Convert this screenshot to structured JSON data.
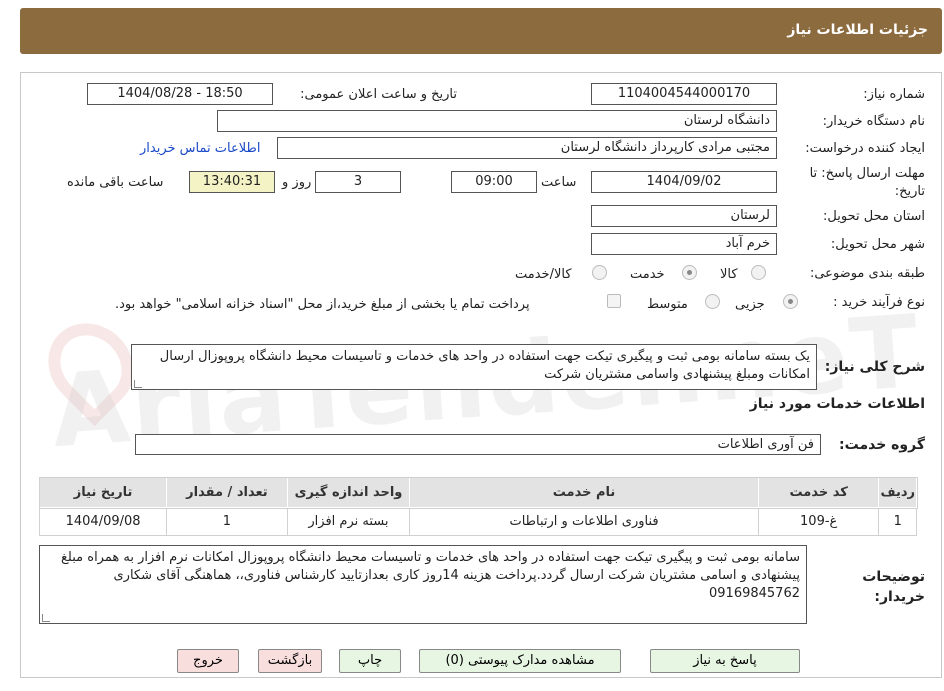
{
  "header": {
    "title": "جزئیات اطلاعات نیاز"
  },
  "watermark": "AriaTender.neT",
  "form": {
    "need_number_label": "شماره نیاز:",
    "need_number": "1104004544000170",
    "announce_label": "تاریخ و ساعت اعلان عمومی:",
    "announce_value": "1404/08/28 - 18:50",
    "buyer_org_label": "نام دستگاه خریدار:",
    "buyer_org": "دانشگاه لرستان",
    "creator_label": "ایجاد کننده درخواست:",
    "creator": "مجتبی مرادی کارپرداز دانشگاه لرستان",
    "contact_link": "اطلاعات تماس خریدار",
    "deadline_label": "مهلت ارسال پاسخ: تا تاریخ:",
    "deadline_date": "1404/09/02",
    "time_label": "ساعت",
    "deadline_time": "09:00",
    "days_value": "3",
    "days_label": "روز و",
    "remaining_time": "13:40:31",
    "remaining_label": "ساعت باقی مانده",
    "province_label": "استان محل تحویل:",
    "province": "لرستان",
    "city_label": "شهر محل تحویل:",
    "city": "خرم آباد",
    "category_label": "طبقه بندی موضوعی:",
    "category_options": [
      "کالا",
      "خدمت",
      "کالا/خدمت"
    ],
    "purchase_type_label": "نوع فرآیند خرید :",
    "purchase_options": [
      "جزیی",
      "متوسط"
    ],
    "payment_note": "پرداخت تمام یا بخشی از مبلغ خرید،از محل \"اسناد خزانه اسلامی\" خواهد بود.",
    "summary_label": "شرح کلی نیاز:",
    "summary_text": "یک بسته سامانه بومی ثبت و پیگیری تیکت جهت استفاده در واحد های خدمات و تاسیسات محیط دانشگاه پروپوزال ارسال امکانات ومبلغ پیشنهادی واسامی مشتریان شرکت",
    "services_heading": "اطلاعات خدمات مورد نیاز",
    "service_group_label": "گروه خدمت:",
    "service_group": "فن آوری اطلاعات"
  },
  "table": {
    "headers": [
      "ردیف",
      "کد خدمت",
      "نام خدمت",
      "واحد اندازه گیری",
      "تعداد / مقدار",
      "تاریخ نیاز"
    ],
    "rows": [
      [
        "1",
        "غ-109",
        "فناوری اطلاعات و ارتباطات",
        "بسته نرم افزار",
        "1",
        "1404/09/08"
      ]
    ]
  },
  "buyer_notes": {
    "label": "توضیحات خریدار:",
    "text": "سامانه بومی ثبت و پیگیری تیکت جهت استفاده در واحد های خدمات و تاسیسات محیط دانشگاه پروپوزال امکانات نرم افزار به همراه مبلغ پیشنهادی و اسامی مشتریان شرکت ارسال گردد.پرداخت هزینه 14روز کاری بعدازتایید کارشناس فناوری،، هماهنگی آقای شکاری 09169845762"
  },
  "buttons": {
    "reply": "پاسخ به نیاز",
    "attachments": "مشاهده مدارک پیوستی (0)",
    "print": "چاپ",
    "back": "بازگشت",
    "exit": "خروج"
  }
}
